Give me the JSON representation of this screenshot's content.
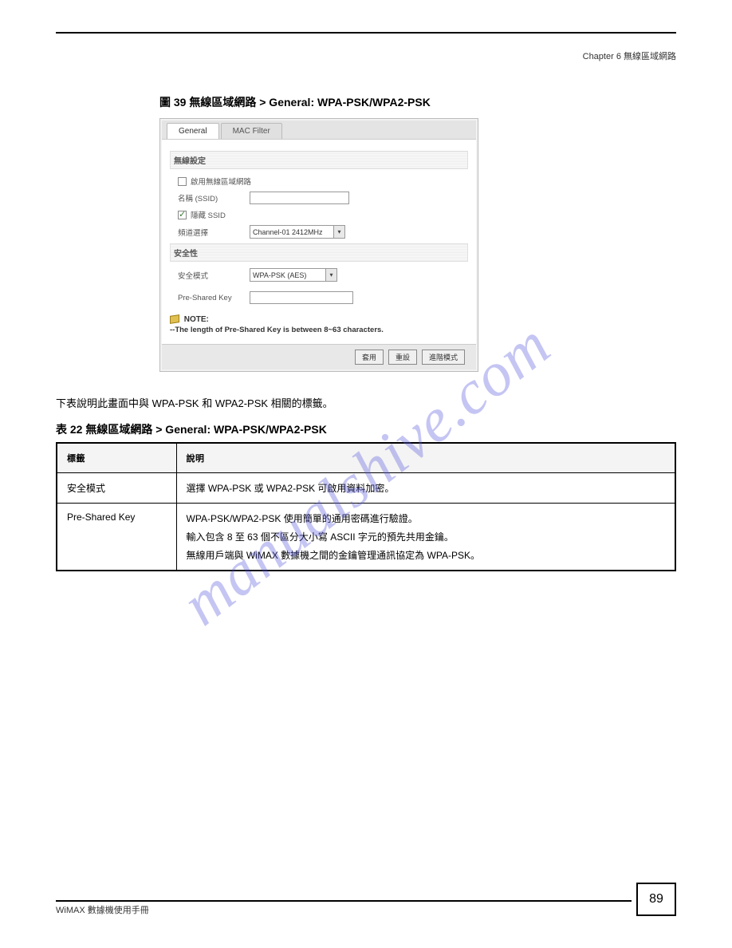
{
  "chapter_header": "Chapter 6 無線區域網路",
  "figure_caption_top": "圖 39   無線區域網路 > General: WPA-PSK/WPA2-PSK",
  "panel": {
    "tabs": {
      "general": "General",
      "mac": "MAC Filter"
    },
    "section_wireless": "無線設定",
    "enable_wlan": "啟用無線區域網路",
    "ssid_label": "名稱 (SSID)",
    "hide_ssid": "隱藏 SSID",
    "channel_label": "頻道選擇",
    "channel_value": "Channel-01 2412MHz",
    "section_security": "安全性",
    "security_mode_label": "安全模式",
    "security_mode_value": "WPA-PSK (AES)",
    "psk_label": "Pre-Shared Key",
    "note_title": "NOTE:",
    "note_text": "--The length of Pre-Shared Key is between 8~63 characters.",
    "btn_apply": "套用",
    "btn_reset": "重設",
    "btn_advanced": "進階模式"
  },
  "body_text": "下表說明此畫面中與 WPA-PSK 和 WPA2-PSK 相關的標籤。",
  "table_caption": "表 22   無線區域網路 > General: WPA-PSK/WPA2-PSK",
  "table": {
    "head_label": "標籤",
    "head_desc": "說明",
    "rows": [
      {
        "label": "安全模式",
        "desc": [
          "選擇 WPA-PSK 或 WPA2-PSK 可啟用資料加密。"
        ]
      },
      {
        "label": "Pre-Shared Key",
        "desc": [
          "WPA-PSK/WPA2-PSK 使用簡單的通用密碼進行驗證。",
          "輸入包含 8 至 63 個不區分大小寫 ASCII 字元的預先共用金鑰。",
          "無線用戶端與 WiMAX 數據機之間的金鑰管理通訊協定為 WPA-PSK。"
        ]
      }
    ]
  },
  "footer_text": "WiMAX 數據機使用手冊",
  "page_number": "89",
  "watermark": "manualshive.com"
}
